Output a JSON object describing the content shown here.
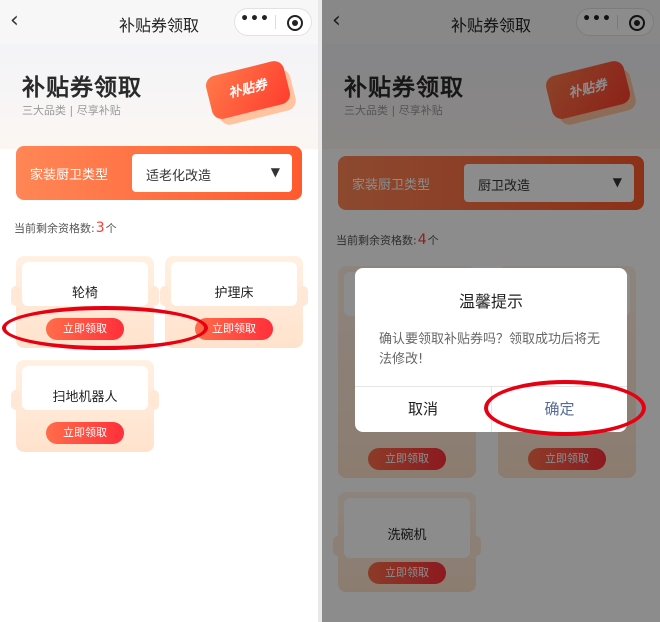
{
  "nav": {
    "title": "补贴券领取",
    "more_glyph": "•••"
  },
  "hero": {
    "title": "补贴券领取",
    "subtitle": "三大品类 | 尽享补贴",
    "ticket_text": "补贴券"
  },
  "selector": {
    "label": "家装厨卫类型"
  },
  "remain": {
    "prefix": "当前剩余资格数:",
    "suffix": "个"
  },
  "screen_left": {
    "selected_type": "适老化改造",
    "remain_count": "3",
    "products": [
      {
        "name": "轮椅",
        "button": "立即领取"
      },
      {
        "name": "护理床",
        "button": "立即领取"
      },
      {
        "name": "扫地机器人",
        "button": "立即领取"
      }
    ]
  },
  "screen_right": {
    "selected_type": "厨卫改造",
    "remain_count": "4",
    "products": [
      {
        "name": "",
        "button": "立即领取"
      },
      {
        "name": "",
        "button": "立即领取"
      },
      {
        "name": "洗碗机",
        "button": "立即领取"
      }
    ],
    "dialog": {
      "title": "温馨提示",
      "message": "确认要领取补贴券吗？领取成功后将无法修改!",
      "cancel": "取消",
      "confirm": "确定"
    }
  },
  "colors": {
    "accent": "#ff5a2e",
    "highlight": "#e60012",
    "confirm_text": "#576b95"
  }
}
